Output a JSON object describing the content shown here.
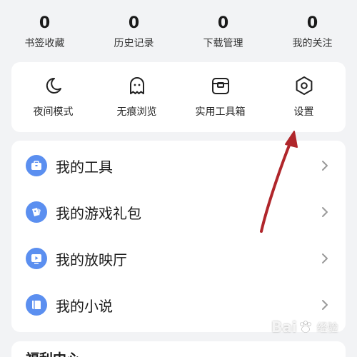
{
  "stats": [
    {
      "count": "0",
      "label": "书签收藏"
    },
    {
      "count": "0",
      "label": "历史记录"
    },
    {
      "count": "0",
      "label": "下载管理"
    },
    {
      "count": "0",
      "label": "我的关注"
    }
  ],
  "quick_actions": [
    {
      "label": "夜间模式",
      "icon": "moon-icon"
    },
    {
      "label": "无痕浏览",
      "icon": "ghost-icon"
    },
    {
      "label": "实用工具箱",
      "icon": "toolbox-icon"
    },
    {
      "label": "设置",
      "icon": "settings-hexagon-icon"
    }
  ],
  "menu": [
    {
      "label": "我的工具",
      "icon": "toolbox-icon"
    },
    {
      "label": "我的游戏礼包",
      "icon": "game-controller-icon"
    },
    {
      "label": "我的放映厅",
      "icon": "play-icon"
    },
    {
      "label": "我的小说",
      "icon": "book-icon"
    }
  ],
  "bottom_section": {
    "label": "福利中心"
  },
  "watermark": {
    "brand_left": "Bai",
    "brand_right": "经验"
  },
  "colors": {
    "accent": "#5b8ff0",
    "annotation_arrow": "#b0262b",
    "background": "#f2f3f5"
  }
}
